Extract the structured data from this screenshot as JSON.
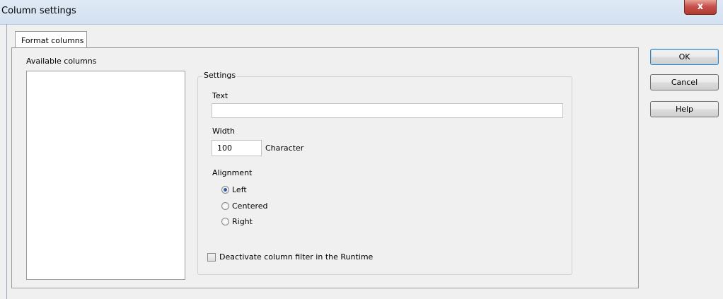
{
  "window": {
    "title": "Column settings",
    "close_glyph": "x"
  },
  "tabs": [
    {
      "label": "Format columns"
    }
  ],
  "available_columns": {
    "label": "Available columns",
    "items": []
  },
  "settings": {
    "group_label": "Settings",
    "text": {
      "label": "Text",
      "value": ""
    },
    "width": {
      "label": "Width",
      "value": "100",
      "unit": "Character"
    },
    "alignment": {
      "label": "Alignment",
      "options": [
        "Left",
        "Centered",
        "Right"
      ],
      "selected": "Left"
    },
    "deactivate_filter": {
      "label": "Deactivate column filter in the Runtime",
      "checked": false
    }
  },
  "buttons": {
    "ok": "OK",
    "cancel": "Cancel",
    "help": "Help"
  }
}
